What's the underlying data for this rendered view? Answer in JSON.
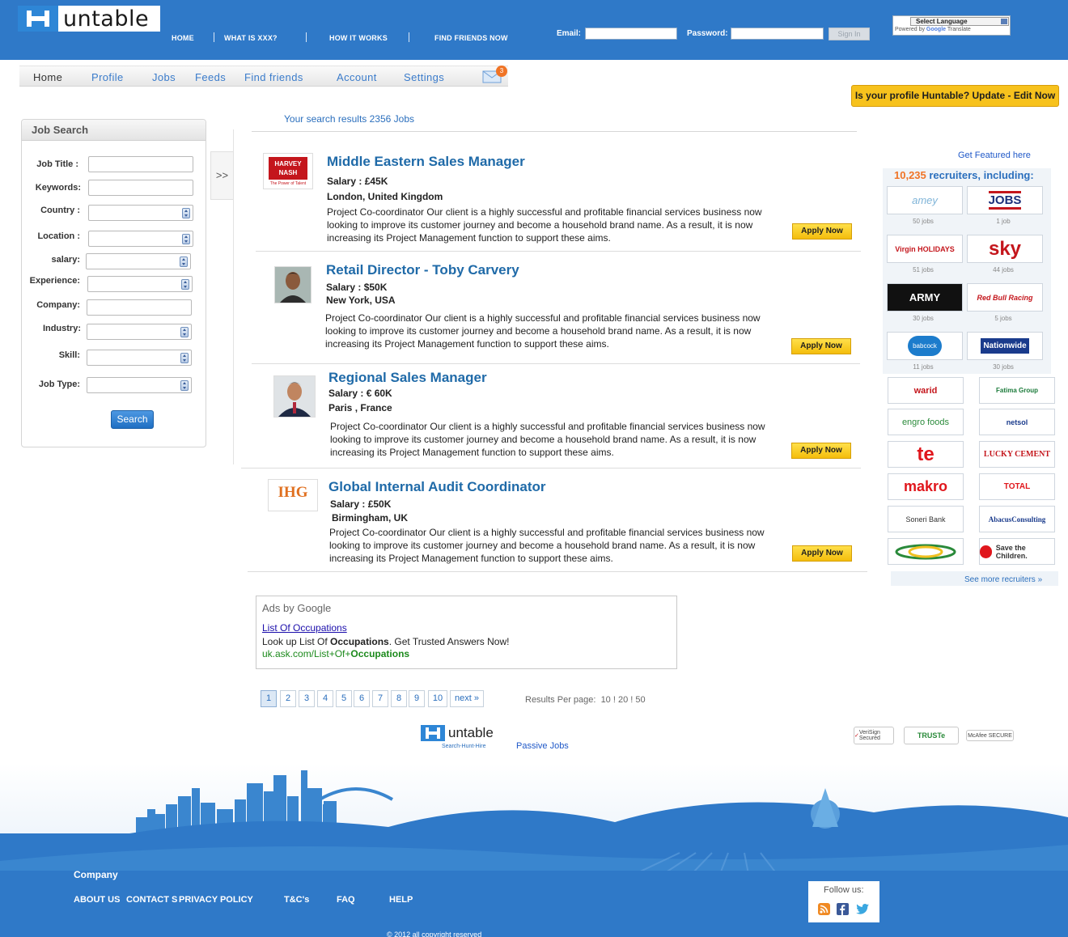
{
  "header": {
    "logo_text": "untable",
    "nav": [
      "HOME",
      "WHAT IS XXX?",
      "HOW IT WORKS",
      "FIND FRIENDS NOW"
    ],
    "email_label": "Email:",
    "password_label": "Password:",
    "signin_label": "Sign In",
    "translate_label": "Select Language",
    "translate_powered": "Powered by",
    "translate_google": "Google",
    "translate_word": "Translate"
  },
  "subnav": {
    "items": [
      "Home",
      "Profile",
      "Jobs",
      "Feeds",
      "Find friends",
      "Account",
      "Settings"
    ],
    "mail_count": "3"
  },
  "profile_banner": "Is your profile Huntable? Update - Edit Now",
  "search": {
    "title": "Job Search",
    "fields": [
      "Job Title :",
      "Keywords:",
      "Country :",
      "Location :",
      "salary:",
      "Experience:",
      "Company:",
      "Industry:",
      "Skill:",
      "Job Type:"
    ],
    "button": "Search"
  },
  "collapse_label": ">>",
  "results_header": "Your search results 2356 Jobs",
  "jobs": [
    {
      "title": "Middle Eastern Sales Manager",
      "salary": "Salary : £45K",
      "location": "London, United Kingdom",
      "desc": "Project Co-coordinator Our client is a highly successful and profitable financial services business now looking to improve its customer journey and become a household brand name. As a result, it is now increasing its Project Management function to support these aims.",
      "apply": "Apply Now",
      "logo_line1": "HARVEY",
      "logo_line2": "NASH",
      "logo_tag": "The Power of Talent"
    },
    {
      "title": "Retail Director - Toby Carvery",
      "salary": "Salary : $50K",
      "location": "New York, USA",
      "desc": "Project Co-coordinator Our client is a highly successful and profitable financial services business now looking to improve its customer journey and become a household brand name. As a result, it is now increasing its Project Management function to support these aims.",
      "apply": "Apply Now"
    },
    {
      "title": "Regional Sales Manager",
      "salary": "Salary : € 60K",
      "location": "Paris , France",
      "desc": "Project Co-coordinator Our client is a highly successful and profitable financial services business now looking to improve its customer journey and become a household brand name. As a result, it is now increasing its Project Management function to support these aims.",
      "apply": "Apply Now"
    },
    {
      "title": "Global Internal Audit Coordinator",
      "salary": "Salary : £50K",
      "location": "Birmingham, UK",
      "desc": "Project Co-coordinator Our client is a highly successful and profitable financial services business now looking to improve its customer journey and become a household brand name. As a result, it is now increasing its Project Management function to support these aims.",
      "apply": "Apply Now",
      "logo_text": "IHG"
    }
  ],
  "sidebar": {
    "featured": "Get Featured here",
    "recruiters_count": "10,235",
    "recruiters_suffix": " recruiters, including:",
    "recruiters": [
      {
        "name": "amey",
        "jobs": "50 jobs"
      },
      {
        "name": "JOBS",
        "jobs": "1 job"
      },
      {
        "name": "Virgin HOLIDAYS",
        "jobs": "51 jobs"
      },
      {
        "name": "sky",
        "jobs": "44 jobs"
      },
      {
        "name": "ARMY",
        "jobs": "30 jobs"
      },
      {
        "name": "Red Bull Racing",
        "jobs": "5 jobs"
      },
      {
        "name": "babcock",
        "jobs": "11 jobs"
      },
      {
        "name": "Nationwide",
        "jobs": "30 jobs"
      }
    ],
    "more_logos": [
      "warid",
      "Fatima Group",
      "engro foods",
      "netsol",
      "te",
      "LUCKY CEMENT",
      "makro",
      "TOTAL",
      "Soneri Bank",
      "AbacusConsulting",
      "",
      "Save the Children."
    ],
    "see_more": "See more recruiters »"
  },
  "ads": {
    "title": "Ads by Google",
    "link": "List Of Occupations",
    "text_a": "Look up List Of ",
    "text_b": "Occupations",
    "text_c": ". Get Trusted Answers Now!",
    "url_a": "uk.ask.com/List+Of+",
    "url_b": "Occupations"
  },
  "pagination": {
    "pages": [
      "1",
      "2",
      "3",
      "4",
      "5",
      "6",
      "7",
      "8",
      "9",
      "10"
    ],
    "next": "next »",
    "per_page_label": "Results Per page:",
    "per_page_options": "10 ! 20 ! 50"
  },
  "footer": {
    "logo_text": "untable",
    "tagline": "Search-Hunt-Hire",
    "passive_jobs": "Passive Jobs",
    "seals": [
      "VeriSign Secured",
      "TRUSTe",
      "McAfee SECURE"
    ],
    "company_heading": "Company",
    "links": [
      "ABOUT US",
      "CONTACT S",
      "PRIVACY POLICY",
      "T&C's",
      "FAQ",
      "HELP"
    ],
    "follow_label": "Follow us:",
    "copyright": "© 2012 all copyright reserved"
  },
  "colors": {
    "header_blue": "#2f79c8",
    "link_blue": "#1f6aa8",
    "apply_yellow": "#f7c21d",
    "accent_orange": "#f07426"
  }
}
